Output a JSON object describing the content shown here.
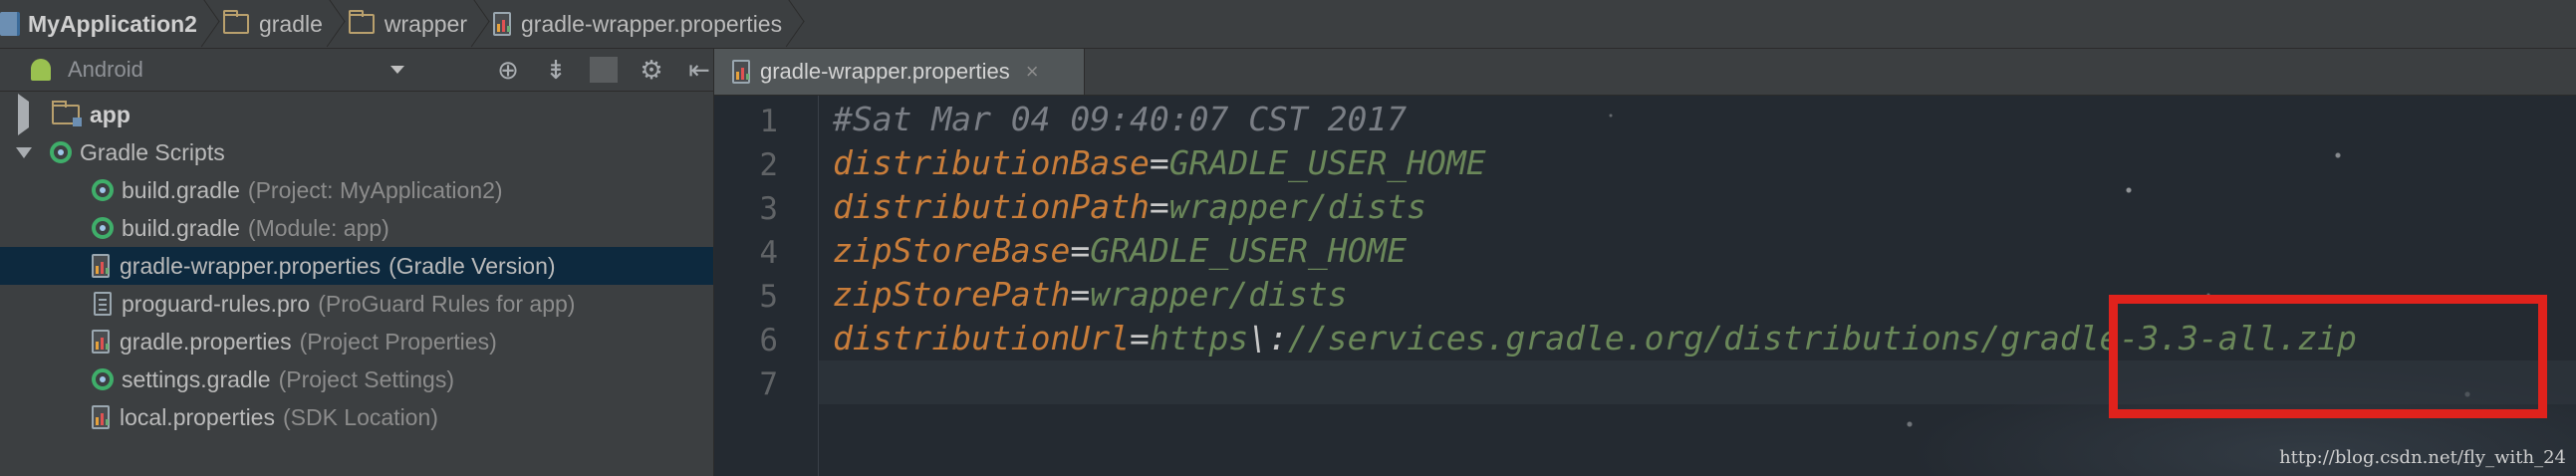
{
  "breadcrumb": [
    {
      "label": "MyApplication2",
      "icon": "module-icon",
      "bold": true
    },
    {
      "label": "gradle",
      "icon": "folder-icon"
    },
    {
      "label": "wrapper",
      "icon": "folder-icon"
    },
    {
      "label": "gradle-wrapper.properties",
      "icon": "properties-file-icon"
    }
  ],
  "project_panel": {
    "view_selector": "Android",
    "tree": [
      {
        "label": "app",
        "hint": "",
        "icon": "app-module-icon",
        "expanded": false
      },
      {
        "label": "Gradle Scripts",
        "hint": "",
        "icon": "gradle-scripts-icon",
        "expanded": true
      },
      {
        "label": "build.gradle",
        "hint": "(Project: MyApplication2)",
        "icon": "gradle-icon"
      },
      {
        "label": "build.gradle",
        "hint": "(Module: app)",
        "icon": "gradle-icon"
      },
      {
        "label": "gradle-wrapper.properties",
        "hint": "(Gradle Version)",
        "icon": "properties-file-icon",
        "selected": true
      },
      {
        "label": "proguard-rules.pro",
        "hint": "(ProGuard Rules for app)",
        "icon": "text-file-icon"
      },
      {
        "label": "gradle.properties",
        "hint": "(Project Properties)",
        "icon": "properties-file-icon"
      },
      {
        "label": "settings.gradle",
        "hint": "(Project Settings)",
        "icon": "gradle-icon"
      },
      {
        "label": "local.properties",
        "hint": "(SDK Location)",
        "icon": "properties-file-icon"
      }
    ]
  },
  "editor": {
    "tab_label": "gradle-wrapper.properties",
    "tab_close": "×",
    "line_numbers": [
      "1",
      "2",
      "3",
      "4",
      "5",
      "6",
      "7"
    ],
    "lines": {
      "l1_comment": "#Sat Mar 04 09:40:07 CST 2017",
      "l2_key": "distributionBase",
      "l2_value": "GRADLE_USER_HOME",
      "l3_key": "distributionPath",
      "l3_value": "wrapper/dists",
      "l4_key": "zipStoreBase",
      "l4_value": "GRADLE_USER_HOME",
      "l5_key": "zipStorePath",
      "l5_value": "wrapper/dists",
      "l6_key": "distributionUrl",
      "l6_value_a": "https",
      "l6_escape": "\\:",
      "l6_value_b": "//services.gradle.org/distributions/gradle-3.3-all.zip"
    },
    "equals": "="
  },
  "watermark": "http://blog.csdn.net/fly_with_24",
  "colors": {
    "highlight_box": "#e0221c",
    "selected_row": "#0d293e",
    "property_key": "#c97d3a",
    "property_value": "#6a8759"
  }
}
